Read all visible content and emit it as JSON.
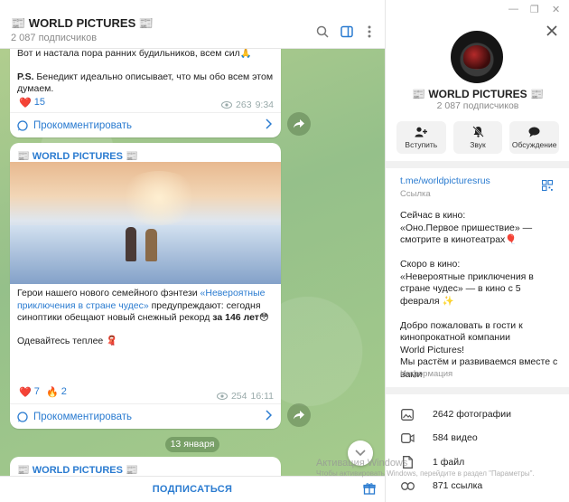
{
  "chat": {
    "title": "📰 WORLD PICTURES 📰",
    "subscribers": "2 087 подписчиков",
    "msg1": {
      "line1": "Вот и настала пора ранних будильников, всем сил🙏",
      "ps_bold": "P.S.",
      "ps_text": " Бенедикт идеально описывает, что мы обо всем этом думаем.",
      "reaction_emoji": "❤️",
      "reaction_count": "15",
      "views": "263",
      "time": "9:34",
      "comment_label": "Прокомментировать"
    },
    "msg2": {
      "channel": "📰 WORLD PICTURES 📰",
      "text_before": "Герои нашего нового семейного фэнтези ",
      "text_link": "«Невероятные приключения в стране чудес»",
      "text_after": " предупреждают: сегодня синоптики обещают новый снежный рекорд ",
      "text_bold": "за 146 лет",
      "text_emoji": "😳",
      "line2": "Одевайтесь теплее 🧣",
      "reaction1_emoji": "❤️",
      "reaction1_count": "7",
      "reaction2_emoji": "🔥",
      "reaction2_count": "2",
      "views": "254",
      "time": "16:11",
      "comment_label": "Прокомментировать"
    },
    "date_separator": "13 января",
    "msg3": {
      "channel": "📰 WORLD PICTURES 📰"
    },
    "subscribe_label": "ПОДПИСАТЬСЯ",
    "watermark_line1": "Активация Windows",
    "watermark_line2": "Чтобы активировать Windows, перейдите в раздел \"Параметры\"."
  },
  "panel": {
    "title": "📰 WORLD PICTURES 📰",
    "subscribers": "2 087 подписчиков",
    "actions": [
      {
        "label": "Вступить",
        "icon": "add-user-icon"
      },
      {
        "label": "Звук",
        "icon": "bell-muted-icon"
      },
      {
        "label": "Обсуждение",
        "icon": "chat-bubble-icon"
      }
    ],
    "link": "t.me/worldpicturesrus",
    "link_caption": "Ссылка",
    "info": "Сейчас в кино:\n«Оно.Первое пришествие» — смотрите в кинотеатрах🎈\n\nСкоро в кино:\n«Невероятные приключения в стране чудес» — в кино с 5 февраля ✨\n\nДобро пожаловать в гости к кинопрокатной компании\nWorld Pictures!\nМы растём и развиваемся вместе с вами",
    "info_caption": "Информация",
    "stats": [
      {
        "text": "2642 фотографии",
        "icon": "photo-icon"
      },
      {
        "text": "584 видео",
        "icon": "video-icon"
      },
      {
        "text": "1 файл",
        "icon": "file-icon"
      },
      {
        "text": "871 ссылка",
        "icon": "link-icon"
      }
    ]
  },
  "colors": {
    "accent": "#2a7bd0",
    "chat_bg": "#9fc48a",
    "heart": "#e53935"
  }
}
